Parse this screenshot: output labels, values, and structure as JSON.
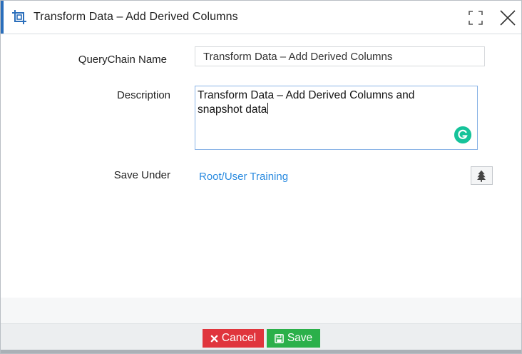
{
  "dialog": {
    "title": "Transform Data – Add Derived Columns",
    "title_icon": "crop-icon",
    "maximize_icon": "maximize-icon",
    "close_icon": "close-icon"
  },
  "form": {
    "name_label": "QueryChain Name",
    "name_value": "Transform Data – Add Derived Columns",
    "description_label": "Description",
    "description_value": "Transform Data – Add Derived Columns and snapshot data",
    "grammarly_icon": "grammarly-icon",
    "save_under_label": "Save Under",
    "save_under_path": "Root/User Training",
    "tree_icon": "tree-icon"
  },
  "footer": {
    "cancel_label": "Cancel",
    "cancel_icon": "x-icon",
    "save_label": "Save",
    "save_icon": "floppy-disk-icon"
  },
  "colors": {
    "accent": "#2a6ebb",
    "link": "#2a8be0",
    "cancel": "#e0353d",
    "save": "#2bb04a",
    "grammarly": "#15c39a"
  }
}
